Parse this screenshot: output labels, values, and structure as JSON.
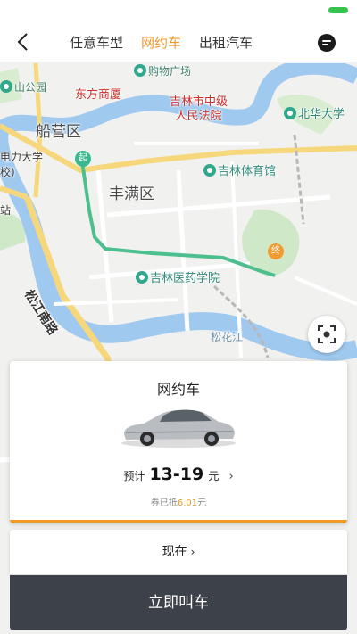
{
  "nav": {
    "tabs": [
      {
        "label": "任意车型"
      },
      {
        "label": "网约车"
      },
      {
        "label": "出租汽车"
      }
    ]
  },
  "map": {
    "labels": {
      "shopping_plaza": "购物广场",
      "shanyuan": "山公园",
      "dongfang": "东方商厦",
      "court": "吉林市中级\n人民法院",
      "beihua": "北华大学",
      "chuanying": "船营区",
      "dianli": "电力大学\n校)",
      "fengman": "丰满区",
      "gym": "吉林体育馆",
      "medical": "吉林医药学院",
      "songjiang_road": "松江南路",
      "songhua_river": "松花江",
      "station": "站"
    },
    "start_marker": "起",
    "end_marker": "终",
    "colors": {
      "route": "#4dbf8f",
      "river": "#9fc9ef",
      "park": "#cfe8c7"
    }
  },
  "card": {
    "title": "网约车",
    "price_prefix": "预计",
    "price_range": "13-19",
    "price_unit": "元",
    "coupon_prefix": "券已抵",
    "coupon_amount": "6.01",
    "coupon_suffix": "元"
  },
  "time": {
    "label": "现在"
  },
  "action": {
    "call_label": "立即叫车"
  },
  "colors": {
    "accent": "#ef9a2b",
    "button_bg": "#3d4149"
  }
}
